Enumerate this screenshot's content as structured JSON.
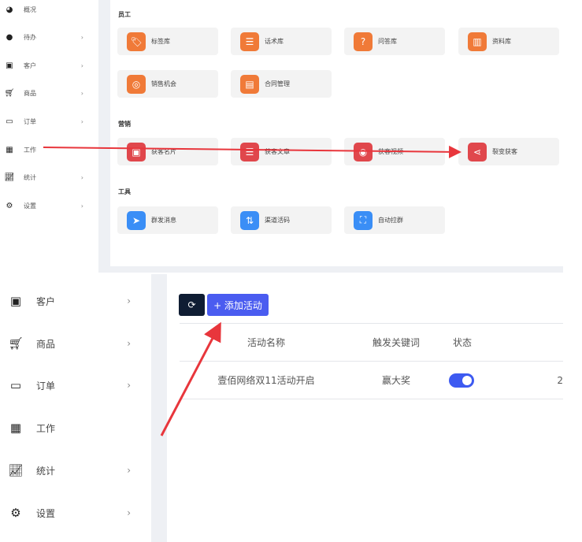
{
  "sidebar_top": [
    {
      "label": "概况",
      "icon": "dashboard-icon",
      "chevron": false
    },
    {
      "label": "待办",
      "icon": "todo-icon",
      "chevron": true
    },
    {
      "label": "客户",
      "icon": "contact-card-icon",
      "chevron": true
    },
    {
      "label": "商品",
      "icon": "cart-icon",
      "chevron": true
    },
    {
      "label": "订单",
      "icon": "money-icon",
      "chevron": true
    },
    {
      "label": "工作",
      "icon": "grid-icon",
      "chevron": false
    },
    {
      "label": "统计",
      "icon": "chart-icon",
      "chevron": true
    },
    {
      "label": "设置",
      "icon": "gear-icon",
      "chevron": true
    }
  ],
  "sections": [
    {
      "title": "员工",
      "items": [
        {
          "label": "标签库",
          "color": "#f07a38"
        },
        {
          "label": "话术库",
          "color": "#f07a38"
        },
        {
          "label": "问答库",
          "color": "#f07a38"
        },
        {
          "label": "资料库",
          "color": "#f07a38"
        },
        {
          "label": "销售机会",
          "color": "#f07a38"
        },
        {
          "label": "合同管理",
          "color": "#f07a38"
        }
      ]
    },
    {
      "title": "营销",
      "items": [
        {
          "label": "获客名片"
        },
        {
          "label": "获客文章"
        },
        {
          "label": "获客视频"
        },
        {
          "label": "裂变获客"
        }
      ]
    },
    {
      "title": "工具",
      "items": [
        {
          "label": "群发消息"
        },
        {
          "label": "渠道活码"
        },
        {
          "label": "自动拉群"
        }
      ]
    }
  ],
  "sidebar_bottom": [
    {
      "label": "客户"
    },
    {
      "label": "商品"
    },
    {
      "label": "订单"
    },
    {
      "label": "工作"
    },
    {
      "label": "统计"
    },
    {
      "label": "设置"
    }
  ],
  "toolbar": {
    "add_label": "+ 添加活动"
  },
  "table": {
    "headers": [
      "活动名称",
      "触发关键词",
      "状态"
    ],
    "rows": [
      {
        "name": "壹佰网络双11活动开启",
        "keyword": "赢大奖",
        "status_on": true,
        "extra": "2"
      }
    ]
  },
  "colors": {
    "accent": "#3d5af1",
    "arrow": "#e8363c"
  }
}
